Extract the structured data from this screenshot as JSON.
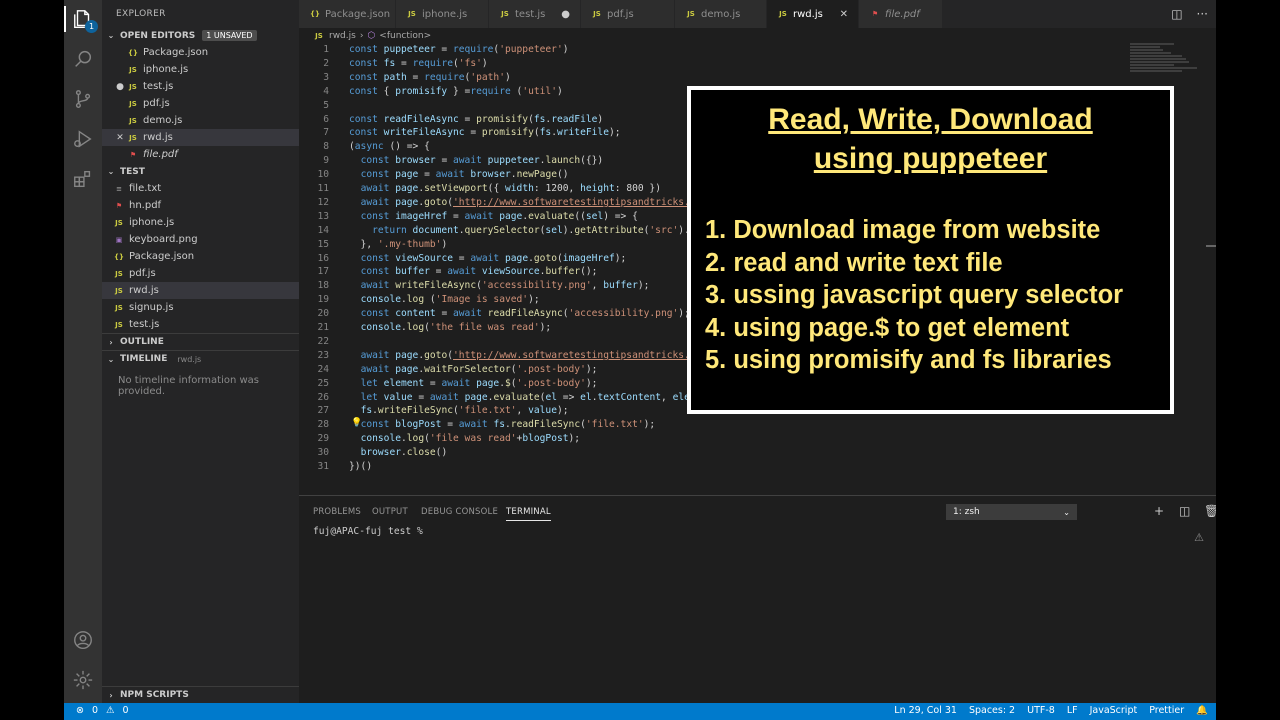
{
  "explorer": {
    "title": "EXPLORER",
    "open_editors": {
      "label": "OPEN EDITORS",
      "badge": "1 UNSAVED",
      "items": [
        {
          "icon": "{}",
          "type": "json",
          "name": "Package.json",
          "mark": ""
        },
        {
          "icon": "JS",
          "type": "js",
          "name": "iphone.js",
          "mark": ""
        },
        {
          "icon": "JS",
          "type": "js",
          "name": "test.js",
          "mark": "●"
        },
        {
          "icon": "JS",
          "type": "js",
          "name": "pdf.js",
          "mark": ""
        },
        {
          "icon": "JS",
          "type": "js",
          "name": "demo.js",
          "mark": ""
        },
        {
          "icon": "JS",
          "type": "js",
          "name": "rwd.js",
          "mark": "✕"
        },
        {
          "icon": "⚑",
          "type": "pdf",
          "name": "file.pdf",
          "mark": ""
        }
      ]
    },
    "folder": {
      "label": "TEST",
      "items": [
        {
          "icon": "≡",
          "type": "txt",
          "name": "file.txt"
        },
        {
          "icon": "⚑",
          "type": "pdf",
          "name": "hn.pdf"
        },
        {
          "icon": "JS",
          "type": "js",
          "name": "iphone.js"
        },
        {
          "icon": "▣",
          "type": "png",
          "name": "keyboard.png"
        },
        {
          "icon": "{}",
          "type": "json",
          "name": "Package.json"
        },
        {
          "icon": "JS",
          "type": "js",
          "name": "pdf.js"
        },
        {
          "icon": "JS",
          "type": "js",
          "name": "rwd.js"
        },
        {
          "icon": "JS",
          "type": "js",
          "name": "signup.js"
        },
        {
          "icon": "JS",
          "type": "js",
          "name": "test.js"
        }
      ]
    },
    "outline_label": "OUTLINE",
    "timeline_label": "TIMELINE",
    "timeline_file": "rwd.js",
    "timeline_message": "No timeline information was provided.",
    "npm_label": "NPM SCRIPTS"
  },
  "tabs": [
    {
      "icon": "{}",
      "type": "json",
      "label": "Package.json",
      "state": ""
    },
    {
      "icon": "JS",
      "type": "js",
      "label": "iphone.js",
      "state": ""
    },
    {
      "icon": "JS",
      "type": "js",
      "label": "test.js",
      "state": "●"
    },
    {
      "icon": "JS",
      "type": "js",
      "label": "pdf.js",
      "state": ""
    },
    {
      "icon": "JS",
      "type": "js",
      "label": "demo.js",
      "state": ""
    },
    {
      "icon": "JS",
      "type": "js",
      "label": "rwd.js",
      "state": "✕"
    },
    {
      "icon": "⚑",
      "type": "pdf",
      "label": "file.pdf",
      "state": ""
    }
  ],
  "breadcrumb": {
    "file": "rwd.js",
    "symbol": "<function>"
  },
  "code_lines": [
    "const puppeteer = require('puppeteer')",
    "const fs = require('fs')",
    "const path = require('path')",
    "const { promisify } =require ('util')",
    "",
    "const readFileAsync = promisify(fs.readFile)",
    "const writeFileAsync = promisify(fs.writeFile);",
    "(async () => {",
    "  const browser = await puppeteer.launch({})",
    "  const page = await browser.newPage()",
    "  await page.setViewport({ width: 1200, height: 800 })",
    "  await page.goto('http://www.softwaretestingtipsandtricks.co",
    "  const imageHref = await page.evaluate((sel) => {",
    "    return document.querySelector(sel).getAttribute('src').re",
    "  }, '.my-thumb')",
    "  const viewSource = await page.goto(imageHref);",
    "  const buffer = await viewSource.buffer();",
    "  await writeFileAsync('accessibility.png', buffer);",
    "  console.log ('Image is saved');",
    "  const content = await readFileAsync('accessibility.png');",
    "  console.log('the file was read');",
    "",
    "  await page.goto('http://www.softwaretestingtipsandtricks.co",
    "  await page.waitForSelector('.post-body');",
    "  let element = await page.$('.post-body');",
    "  let value = await page.evaluate(el => el.textContent, eleme",
    "  fs.writeFileSync('file.txt', value);",
    "  const blogPost = await fs.readFileSync('file.txt');",
    "  console.log('file was read'+blogPost);",
    "  browser.close()",
    "})()"
  ],
  "overlay": {
    "title_line1": "Read, Write, Download",
    "title_line2": "using puppeteer",
    "items": [
      "1. Download image from website",
      "2. read and write text file",
      "3. ussing javascript query selector",
      "4. using page.$ to get element",
      "5. using promisify and fs libraries"
    ]
  },
  "panel": {
    "tabs": [
      "PROBLEMS",
      "OUTPUT",
      "DEBUG CONSOLE",
      "TERMINAL"
    ],
    "active_tab": "TERMINAL",
    "terminal_select": "1: zsh",
    "prompt": "fuj@APAC-fuj test %"
  },
  "status": {
    "errors": "0",
    "warnings": "0",
    "position": "Ln 29, Col 31",
    "spaces": "Spaces: 2",
    "encoding": "UTF-8",
    "eol": "LF",
    "language": "JavaScript",
    "formatter": "Prettier"
  },
  "activity_badge": "1",
  "colors": {
    "accent": "#007acc",
    "overlay_text": "#ffe87a",
    "sidebar": "#252526",
    "editor": "#1e1e1e"
  }
}
